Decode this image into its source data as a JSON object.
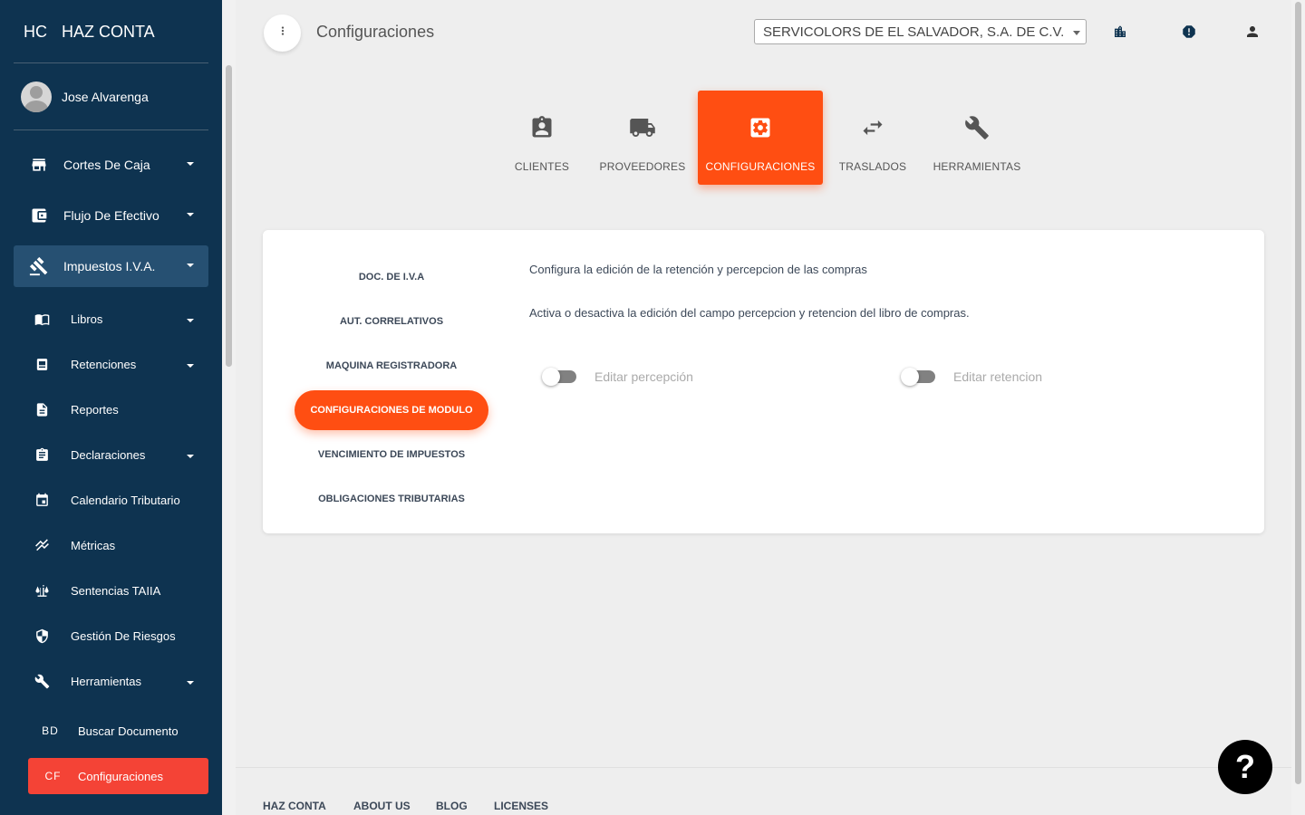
{
  "brand": {
    "mini": "HC",
    "name": "HAZ CONTA"
  },
  "user": {
    "name": "Jose Alvarenga"
  },
  "sidebar": {
    "items": [
      {
        "label": "Cortes De Caja",
        "icon": "store-icon"
      },
      {
        "label": "Flujo De Efectivo",
        "icon": "wallet-icon"
      },
      {
        "label": "Impuestos I.V.A.",
        "icon": "gavel-icon"
      }
    ],
    "sub_items": [
      {
        "label": "Libros",
        "icon": "book-icon"
      },
      {
        "label": "Retenciones",
        "icon": "receipt-icon"
      },
      {
        "label": "Reportes",
        "icon": "document-icon"
      },
      {
        "label": "Declaraciones",
        "icon": "clipboard-icon"
      },
      {
        "label": "Calendario Tributario",
        "icon": "calendar-icon"
      },
      {
        "label": "Métricas",
        "icon": "chart-icon"
      },
      {
        "label": "Sentencias TAIIA",
        "icon": "balance-icon"
      },
      {
        "label": "Gestión De Riesgos",
        "icon": "shield-icon"
      },
      {
        "label": "Herramientas",
        "icon": "wrench-icon"
      }
    ],
    "abbr_items": [
      {
        "abbr": "BD",
        "label": "Buscar Documento"
      },
      {
        "abbr": "CF",
        "label": "Configuraciones"
      }
    ]
  },
  "header": {
    "title": "Configuraciones",
    "company": "SERVICOLORS DE EL SALVADOR, S.A. DE C.V."
  },
  "tabs": [
    {
      "label": "CLIENTES"
    },
    {
      "label": "PROVEEDORES"
    },
    {
      "label": "CONFIGURACIONES"
    },
    {
      "label": "TRASLADOS"
    },
    {
      "label": "HERRAMIENTAS"
    }
  ],
  "settings_nav": [
    "DOC. DE I.V.A",
    "AUT. CORRELATIVOS",
    "MAQUINA REGISTRADORA",
    "CONFIGURACIONES DE MODULO",
    "VENCIMIENTO DE IMPUESTOS",
    "OBLIGACIONES TRIBUTARIAS"
  ],
  "content": {
    "heading": "Configura la edición de la retención y percepcion de las compras",
    "description": "Activa o desactiva la edición del campo percepcion y retencion del libro de compras.",
    "toggles": [
      {
        "label": "Editar percepción",
        "on": false
      },
      {
        "label": "Editar retencion",
        "on": false
      }
    ]
  },
  "footer": [
    "HAZ CONTA",
    "ABOUT US",
    "BLOG",
    "LICENSES"
  ],
  "help": {
    "label": "?"
  },
  "colors": {
    "sidebar": "#0e3350",
    "accent": "#ff4e12",
    "active_nav": "#f44336"
  }
}
